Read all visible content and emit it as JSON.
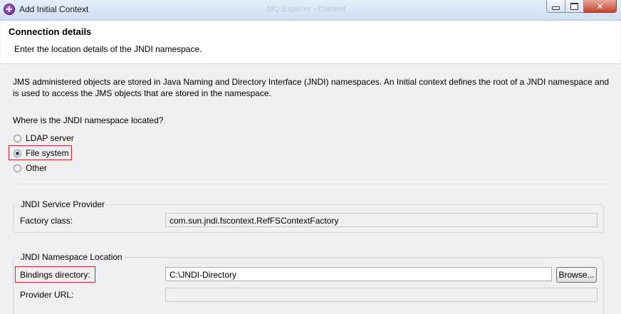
{
  "window": {
    "title": "Add Initial Context",
    "background_title": "MQ Explorer - Content"
  },
  "banner": {
    "title": "Connection details",
    "description": "Enter the location details of the JNDI namespace."
  },
  "intro": {
    "text": "JMS administered objects are stored in Java Naming and Directory Interface (JNDI) namespaces. An Initial context defines the root of a JNDI namespace and is used to access the JMS objects that are stored in the namespace."
  },
  "location": {
    "question": "Where is the JNDI namespace located?",
    "options": [
      {
        "label": "LDAP server",
        "selected": false
      },
      {
        "label": "File system",
        "selected": true
      },
      {
        "label": "Other",
        "selected": false
      }
    ]
  },
  "service_provider": {
    "group_label": "JNDI Service Provider",
    "factory_label": "Factory class:",
    "factory_value": "com.sun.jndi.fscontext.RefFSContextFactory"
  },
  "namespace_location": {
    "group_label": "JNDI Namespace Location",
    "bindings_label": "Bindings directory:",
    "bindings_value": "C:\\JNDI-Directory",
    "browse_label": "Browse...",
    "provider_label": "Provider URL:",
    "provider_value": ""
  },
  "colors": {
    "highlight": "#d1263a",
    "radio_dot": "#2a3c66"
  }
}
